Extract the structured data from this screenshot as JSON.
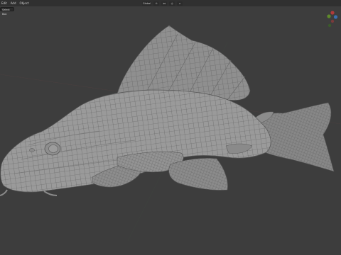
{
  "menu": {
    "items": [
      "Edit",
      "Add",
      "Object"
    ]
  },
  "toolbar": {
    "transform_space": "Global",
    "mode_chip": "Select Box"
  },
  "viewport": {
    "subject_icon": "fish-mesh-icon"
  },
  "colors": {
    "background": "#3d3d3d",
    "header": "#303030",
    "mesh_fill": "#8a8a8a",
    "wire": "#5a5a5a",
    "axis_x": "#b03a3a",
    "axis_y": "#5f8a2b",
    "axis_z": "#3a6fb0"
  }
}
